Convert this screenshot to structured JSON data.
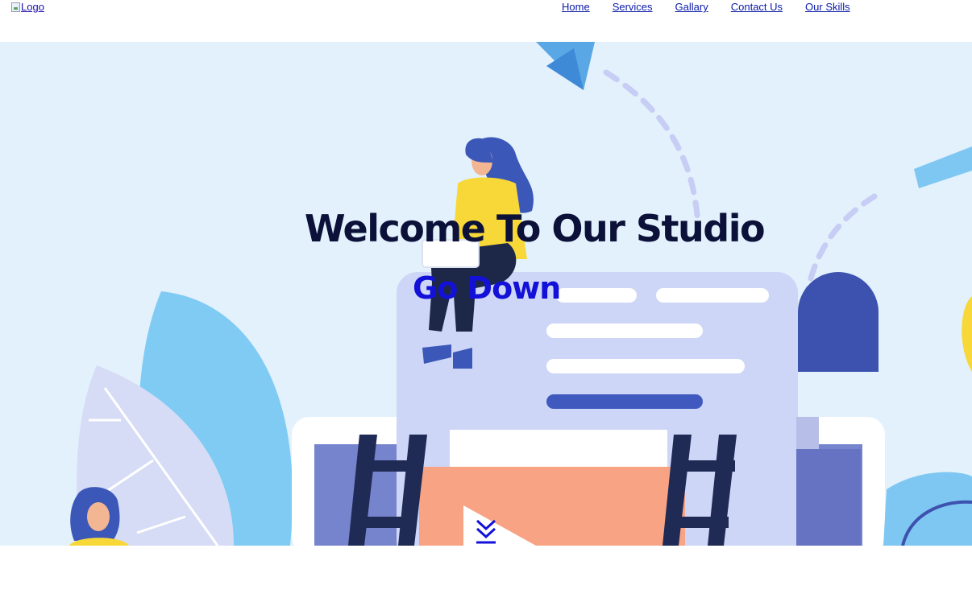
{
  "header": {
    "logo_alt": "Logo",
    "nav": [
      {
        "label": "Home"
      },
      {
        "label": "Services"
      },
      {
        "label": "Gallary"
      },
      {
        "label": "Contact Us"
      },
      {
        "label": "Our Skills"
      }
    ]
  },
  "hero": {
    "title": "Welcome To Our Studio",
    "link": "Go Down",
    "arrow_icon": "chevrons-down-icon"
  },
  "colors": {
    "hero_bg": "#e2f1fc",
    "title": "#0b1138",
    "link": "#1311d8",
    "nav_link": "#0a1aa8"
  }
}
